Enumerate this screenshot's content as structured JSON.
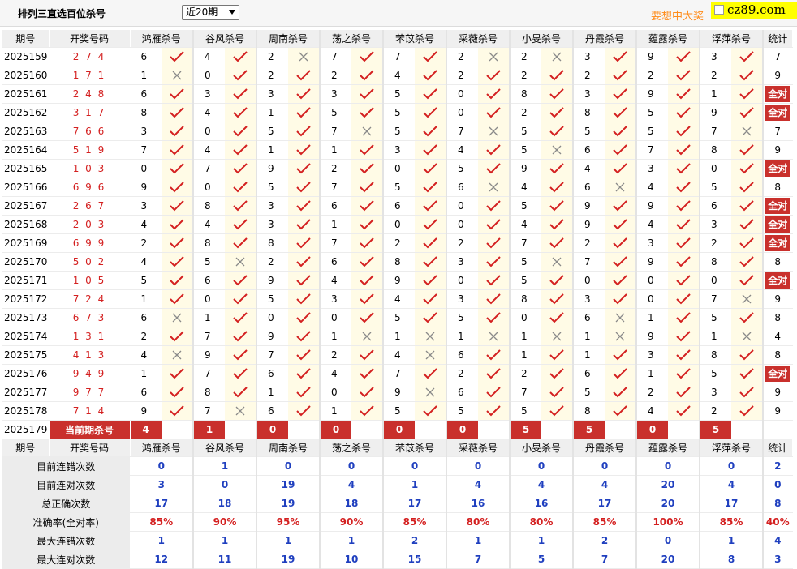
{
  "header": {
    "title": "排列三直选百位杀号",
    "period_select": "近20期",
    "ad_text": "要想中大奖",
    "ad_logo": "cz89.com"
  },
  "columns": {
    "issue": "期号",
    "winning": "开奖号码",
    "experts": [
      "鸿雁杀号",
      "谷风杀号",
      "周南杀号",
      "荡之杀号",
      "芣苡杀号",
      "采薇杀号",
      "小旻杀号",
      "丹霞杀号",
      "蕴露杀号",
      "浮萍杀号"
    ],
    "total": "统计"
  },
  "rows": [
    {
      "issue": "2025159",
      "winning": "2 7 4",
      "kills": [
        6,
        4,
        2,
        7,
        7,
        2,
        2,
        3,
        9,
        3
      ],
      "ok": [
        1,
        1,
        0,
        1,
        1,
        0,
        0,
        1,
        1,
        1
      ],
      "total": "7"
    },
    {
      "issue": "2025160",
      "winning": "1 7 1",
      "kills": [
        1,
        0,
        2,
        2,
        4,
        2,
        2,
        2,
        2,
        2
      ],
      "ok": [
        0,
        1,
        1,
        1,
        1,
        1,
        1,
        1,
        1,
        1
      ],
      "total": "9"
    },
    {
      "issue": "2025161",
      "winning": "2 4 8",
      "kills": [
        6,
        3,
        3,
        3,
        5,
        0,
        8,
        3,
        9,
        1
      ],
      "ok": [
        1,
        1,
        1,
        1,
        1,
        1,
        1,
        1,
        1,
        1
      ],
      "total": "全对"
    },
    {
      "issue": "2025162",
      "winning": "3 1 7",
      "kills": [
        8,
        4,
        1,
        5,
        5,
        0,
        2,
        8,
        5,
        9
      ],
      "ok": [
        1,
        1,
        1,
        1,
        1,
        1,
        1,
        1,
        1,
        1
      ],
      "total": "全对"
    },
    {
      "issue": "2025163",
      "winning": "7 6 6",
      "kills": [
        3,
        0,
        5,
        7,
        5,
        7,
        5,
        5,
        5,
        7
      ],
      "ok": [
        1,
        1,
        1,
        0,
        1,
        0,
        1,
        1,
        1,
        0
      ],
      "total": "7"
    },
    {
      "issue": "2025164",
      "winning": "5 1 9",
      "kills": [
        7,
        4,
        1,
        1,
        3,
        4,
        5,
        6,
        7,
        8
      ],
      "ok": [
        1,
        1,
        1,
        1,
        1,
        1,
        0,
        1,
        1,
        1
      ],
      "total": "9"
    },
    {
      "issue": "2025165",
      "winning": "1 0 3",
      "kills": [
        0,
        7,
        9,
        2,
        0,
        5,
        9,
        4,
        3,
        0
      ],
      "ok": [
        1,
        1,
        1,
        1,
        1,
        1,
        1,
        1,
        1,
        1
      ],
      "total": "全对"
    },
    {
      "issue": "2025166",
      "winning": "6 9 6",
      "kills": [
        9,
        0,
        5,
        7,
        5,
        6,
        4,
        6,
        4,
        5
      ],
      "ok": [
        1,
        1,
        1,
        1,
        1,
        0,
        1,
        0,
        1,
        1
      ],
      "total": "8"
    },
    {
      "issue": "2025167",
      "winning": "2 6 7",
      "kills": [
        3,
        8,
        3,
        6,
        6,
        0,
        5,
        9,
        9,
        6
      ],
      "ok": [
        1,
        1,
        1,
        1,
        1,
        1,
        1,
        1,
        1,
        1
      ],
      "total": "全对"
    },
    {
      "issue": "2025168",
      "winning": "2 0 3",
      "kills": [
        4,
        4,
        3,
        1,
        0,
        0,
        4,
        9,
        4,
        3
      ],
      "ok": [
        1,
        1,
        1,
        1,
        1,
        1,
        1,
        1,
        1,
        1
      ],
      "total": "全对"
    },
    {
      "issue": "2025169",
      "winning": "6 9 9",
      "kills": [
        2,
        8,
        8,
        7,
        2,
        2,
        7,
        2,
        3,
        2
      ],
      "ok": [
        1,
        1,
        1,
        1,
        1,
        1,
        1,
        1,
        1,
        1
      ],
      "total": "全对"
    },
    {
      "issue": "2025170",
      "winning": "5 0 2",
      "kills": [
        4,
        5,
        2,
        6,
        8,
        3,
        5,
        7,
        9,
        8
      ],
      "ok": [
        1,
        0,
        1,
        1,
        1,
        1,
        0,
        1,
        1,
        1
      ],
      "total": "8"
    },
    {
      "issue": "2025171",
      "winning": "1 0 5",
      "kills": [
        5,
        6,
        9,
        4,
        9,
        0,
        5,
        0,
        0,
        0
      ],
      "ok": [
        1,
        1,
        1,
        1,
        1,
        1,
        1,
        1,
        1,
        1
      ],
      "total": "全对"
    },
    {
      "issue": "2025172",
      "winning": "7 2 4",
      "kills": [
        1,
        0,
        5,
        3,
        4,
        3,
        8,
        3,
        0,
        7
      ],
      "ok": [
        1,
        1,
        1,
        1,
        1,
        1,
        1,
        1,
        1,
        0
      ],
      "total": "9"
    },
    {
      "issue": "2025173",
      "winning": "6 7 3",
      "kills": [
        6,
        1,
        0,
        0,
        5,
        5,
        0,
        6,
        1,
        5
      ],
      "ok": [
        0,
        1,
        1,
        1,
        1,
        1,
        1,
        0,
        1,
        1
      ],
      "total": "8"
    },
    {
      "issue": "2025174",
      "winning": "1 3 1",
      "kills": [
        2,
        7,
        9,
        1,
        1,
        1,
        1,
        1,
        9,
        1
      ],
      "ok": [
        1,
        1,
        1,
        0,
        0,
        0,
        0,
        0,
        1,
        0
      ],
      "total": "4"
    },
    {
      "issue": "2025175",
      "winning": "4 1 3",
      "kills": [
        4,
        9,
        7,
        2,
        4,
        6,
        1,
        1,
        3,
        8
      ],
      "ok": [
        0,
        1,
        1,
        1,
        0,
        1,
        1,
        1,
        1,
        1
      ],
      "total": "8"
    },
    {
      "issue": "2025176",
      "winning": "9 4 9",
      "kills": [
        1,
        7,
        6,
        4,
        7,
        2,
        2,
        6,
        1,
        5
      ],
      "ok": [
        1,
        1,
        1,
        1,
        1,
        1,
        1,
        1,
        1,
        1
      ],
      "total": "全对"
    },
    {
      "issue": "2025177",
      "winning": "9 7 7",
      "kills": [
        6,
        8,
        1,
        0,
        9,
        6,
        7,
        5,
        2,
        3
      ],
      "ok": [
        1,
        1,
        1,
        1,
        0,
        1,
        1,
        1,
        1,
        1
      ],
      "total": "9"
    },
    {
      "issue": "2025178",
      "winning": "7 1 4",
      "kills": [
        9,
        7,
        6,
        1,
        5,
        5,
        5,
        8,
        4,
        2
      ],
      "ok": [
        1,
        0,
        1,
        1,
        1,
        1,
        1,
        1,
        1,
        1
      ],
      "total": "9"
    }
  ],
  "current": {
    "issue": "2025179",
    "label": "当前期杀号",
    "kills": [
      4,
      1,
      0,
      0,
      0,
      0,
      5,
      5,
      0,
      5
    ]
  },
  "stats": [
    {
      "label": "目前连错次数",
      "values": [
        "0",
        "1",
        "0",
        "0",
        "0",
        "0",
        "0",
        "0",
        "0",
        "0"
      ],
      "total": "2",
      "red": false
    },
    {
      "label": "目前连对次数",
      "values": [
        "3",
        "0",
        "19",
        "4",
        "1",
        "4",
        "4",
        "4",
        "20",
        "4"
      ],
      "total": "0",
      "red": false
    },
    {
      "label": "总正确次数",
      "values": [
        "17",
        "18",
        "19",
        "18",
        "17",
        "16",
        "16",
        "17",
        "20",
        "17"
      ],
      "total": "8",
      "red": false
    },
    {
      "label": "准确率(全对率)",
      "values": [
        "85%",
        "90%",
        "95%",
        "90%",
        "85%",
        "80%",
        "80%",
        "85%",
        "100%",
        "85%"
      ],
      "total": "40%",
      "red": true
    },
    {
      "label": "最大连错次数",
      "values": [
        "1",
        "1",
        "1",
        "1",
        "2",
        "1",
        "1",
        "2",
        "0",
        "1"
      ],
      "total": "4",
      "red": false
    },
    {
      "label": "最大连对次数",
      "values": [
        "12",
        "11",
        "19",
        "10",
        "15",
        "7",
        "5",
        "7",
        "20",
        "8"
      ],
      "total": "3",
      "red": false
    }
  ],
  "marks": {
    "ok": "check-icon",
    "bad": "cross-icon",
    "check_color": "#d42020",
    "cross_color": "#8a8a8a",
    "badge_color": "#c9302c"
  }
}
